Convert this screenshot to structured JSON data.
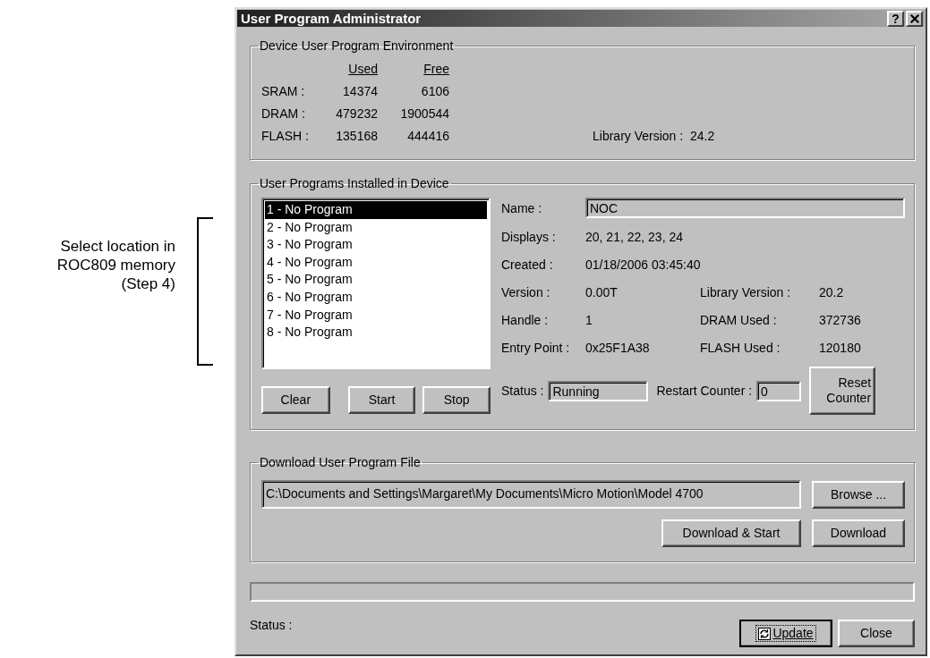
{
  "annotation": {
    "lines": [
      "Select location in",
      "ROC809 memory",
      "(Step 4)"
    ]
  },
  "window": {
    "title": "User Program Administrator",
    "help_button": "?"
  },
  "environment": {
    "legend": "Device User Program Environment",
    "columns": [
      "Used",
      "Free"
    ],
    "rows": [
      {
        "label": "SRAM :",
        "used": "14374",
        "free": "6106"
      },
      {
        "label": "DRAM :",
        "used": "479232",
        "free": "1900544"
      },
      {
        "label": "FLASH :",
        "used": "135168",
        "free": "444416"
      }
    ],
    "library_version": {
      "label": "Library Version :",
      "value": "24.2"
    }
  },
  "programs": {
    "legend": "User Programs Installed in Device",
    "items": [
      {
        "label": "1 - No Program",
        "selected": true
      },
      {
        "label": "2 - No Program",
        "selected": false
      },
      {
        "label": "3 - No Program",
        "selected": false
      },
      {
        "label": "4 - No Program",
        "selected": false
      },
      {
        "label": "5 - No Program",
        "selected": false
      },
      {
        "label": "6 - No Program",
        "selected": false
      },
      {
        "label": "7 - No Program",
        "selected": false
      },
      {
        "label": "8 - No Program",
        "selected": false
      }
    ],
    "buttons": [
      "Clear",
      "Start",
      "Stop"
    ],
    "name": {
      "label": "Name :",
      "value": "NOC"
    },
    "details": [
      {
        "label": "Displays :",
        "value": "20, 21, 22, 23, 24"
      },
      {
        "label": "Created :",
        "value": "01/18/2006 03:45:40"
      },
      {
        "label": "Version :",
        "value": "0.00T",
        "extra_label": "Library Version :",
        "extra_value": "20.2"
      },
      {
        "label": "Handle :",
        "value": "1",
        "extra_label": "DRAM Used :",
        "extra_value": "372736"
      },
      {
        "label": "Entry Point :",
        "value": "0x25F1A38",
        "extra_label": "FLASH Used :",
        "extra_value": "120180"
      }
    ],
    "status": {
      "label": "Status :",
      "value": "Running"
    },
    "restart_counter": {
      "label": "Restart Counter :",
      "value": "0"
    },
    "reset_button": "Reset Counter"
  },
  "download": {
    "legend": "Download User Program File",
    "path": "C:\\Documents and Settings\\Margaret\\My Documents\\Micro Motion\\Model 4700",
    "browse_button": "Browse ...",
    "buttons": [
      "Download & Start",
      "Download"
    ]
  },
  "footer": {
    "progress": {
      "level": 0
    },
    "status_label": "Status :",
    "update_button": "Update",
    "close_button": "Close"
  }
}
